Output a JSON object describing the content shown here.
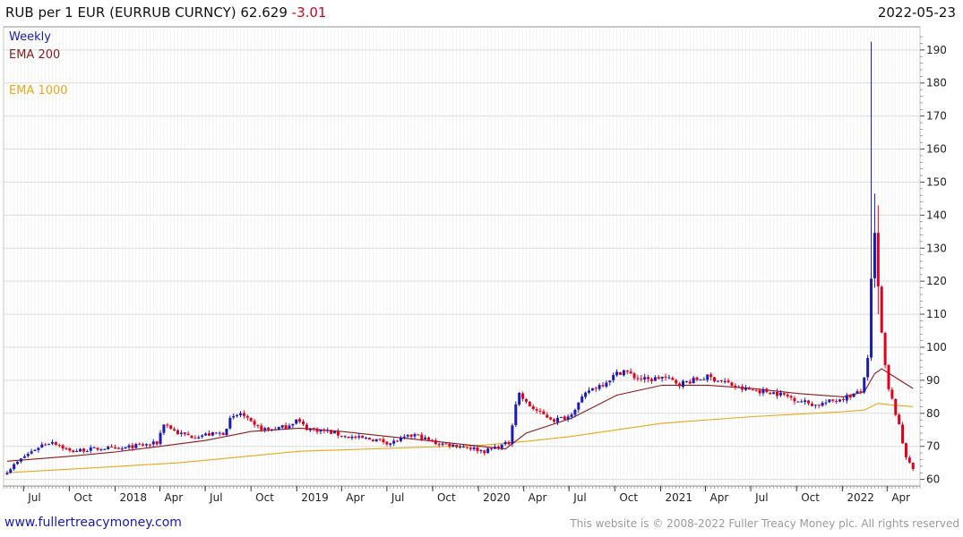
{
  "header": {
    "title": "RUB per 1 EUR (EURRUB CURNCY) 62.629",
    "change": "-3.01",
    "date": "2022-05-23"
  },
  "footer": {
    "left": "www.fullertreacymoney.com",
    "right": "This website is © 2008-2022 Fuller Treacy Money plc. All rights reserved"
  },
  "colors": {
    "up": "#1a1ab8",
    "down": "#e0001b",
    "ema200": "#8b1a1a",
    "ema1000": "#e6a817",
    "grid": "#d9d9d9"
  },
  "chart_data": {
    "type": "candlestick",
    "title": "RUB per 1 EUR (EURRUB CURNCY)",
    "frequency_label": "Weekly",
    "legend": [
      "Weekly",
      "EMA 200",
      "EMA 1000"
    ],
    "ylim": [
      58,
      197
    ],
    "yticks": [
      60,
      70,
      80,
      90,
      100,
      110,
      120,
      130,
      140,
      150,
      160,
      170,
      180,
      190
    ],
    "xlim": [
      "2017-05-22",
      "2022-06-06"
    ],
    "xticks": [
      {
        "label": "Jul",
        "date": "2017-07-01"
      },
      {
        "label": "Oct",
        "date": "2017-10-01"
      },
      {
        "label": "2018",
        "date": "2018-01-01"
      },
      {
        "label": "Apr",
        "date": "2018-04-01"
      },
      {
        "label": "Jul",
        "date": "2018-07-01"
      },
      {
        "label": "Oct",
        "date": "2018-10-01"
      },
      {
        "label": "2019",
        "date": "2019-01-01"
      },
      {
        "label": "Apr",
        "date": "2019-04-01"
      },
      {
        "label": "Jul",
        "date": "2019-07-01"
      },
      {
        "label": "Oct",
        "date": "2019-10-01"
      },
      {
        "label": "2020",
        "date": "2020-01-01"
      },
      {
        "label": "Apr",
        "date": "2020-04-01"
      },
      {
        "label": "Jul",
        "date": "2020-07-01"
      },
      {
        "label": "Oct",
        "date": "2020-10-01"
      },
      {
        "label": "2021",
        "date": "2021-01-01"
      },
      {
        "label": "Apr",
        "date": "2021-04-01"
      },
      {
        "label": "Jul",
        "date": "2021-07-01"
      },
      {
        "label": "Oct",
        "date": "2021-10-01"
      },
      {
        "label": "2022",
        "date": "2022-01-01"
      },
      {
        "label": "Apr",
        "date": "2022-04-01"
      }
    ],
    "close_path": [
      [
        "2017-05-29",
        62.5
      ],
      [
        "2017-07-03",
        67
      ],
      [
        "2017-08-07",
        70.5
      ],
      [
        "2017-08-28",
        71.5
      ],
      [
        "2017-10-02",
        68.5
      ],
      [
        "2017-11-06",
        69
      ],
      [
        "2017-12-11",
        69.5
      ],
      [
        "2018-01-08",
        69
      ],
      [
        "2018-02-05",
        70
      ],
      [
        "2018-03-05",
        70.5
      ],
      [
        "2018-03-26",
        71
      ],
      [
        "2018-04-09",
        77
      ],
      [
        "2018-05-07",
        74
      ],
      [
        "2018-06-04",
        73
      ],
      [
        "2018-07-02",
        73.5
      ],
      [
        "2018-08-06",
        74
      ],
      [
        "2018-08-20",
        78
      ],
      [
        "2018-09-10",
        80
      ],
      [
        "2018-10-08",
        76
      ],
      [
        "2018-11-05",
        75
      ],
      [
        "2018-12-10",
        76
      ],
      [
        "2018-12-31",
        78
      ],
      [
        "2019-01-21",
        75.5
      ],
      [
        "2019-03-04",
        74.5
      ],
      [
        "2019-04-08",
        73
      ],
      [
        "2019-05-06",
        72.5
      ],
      [
        "2019-06-10",
        72
      ],
      [
        "2019-07-08",
        71
      ],
      [
        "2019-08-05",
        72.5
      ],
      [
        "2019-08-26",
        73.5
      ],
      [
        "2019-10-07",
        71
      ],
      [
        "2019-11-04",
        70.5
      ],
      [
        "2019-12-09",
        69.8
      ],
      [
        "2020-01-13",
        68.5
      ],
      [
        "2020-02-10",
        70
      ],
      [
        "2020-03-02",
        71
      ],
      [
        "2020-03-09",
        77
      ],
      [
        "2020-03-16",
        83
      ],
      [
        "2020-03-23",
        86
      ],
      [
        "2020-04-06",
        83
      ],
      [
        "2020-05-04",
        80
      ],
      [
        "2020-06-01",
        78
      ],
      [
        "2020-06-29",
        79
      ],
      [
        "2020-07-20",
        83
      ],
      [
        "2020-08-10",
        87
      ],
      [
        "2020-09-07",
        89
      ],
      [
        "2020-10-05",
        92
      ],
      [
        "2020-10-19",
        93
      ],
      [
        "2020-11-09",
        91
      ],
      [
        "2020-12-07",
        90
      ],
      [
        "2021-01-04",
        91
      ],
      [
        "2021-02-08",
        89
      ],
      [
        "2021-03-08",
        90
      ],
      [
        "2021-04-05",
        91
      ],
      [
        "2021-05-10",
        89.5
      ],
      [
        "2021-06-07",
        87.5
      ],
      [
        "2021-07-05",
        87
      ],
      [
        "2021-08-09",
        86.5
      ],
      [
        "2021-09-06",
        85.5
      ],
      [
        "2021-10-04",
        84
      ],
      [
        "2021-11-08",
        82.5
      ],
      [
        "2021-12-06",
        83.5
      ],
      [
        "2022-01-10",
        85
      ],
      [
        "2022-02-07",
        86.5
      ],
      [
        "2022-02-21",
        96
      ],
      [
        "2022-02-28",
        120
      ],
      [
        "2022-03-07",
        134
      ],
      [
        "2022-03-14",
        118
      ],
      [
        "2022-03-21",
        104
      ],
      [
        "2022-03-28",
        94
      ],
      [
        "2022-04-04",
        87
      ],
      [
        "2022-04-11",
        84
      ],
      [
        "2022-04-18",
        80
      ],
      [
        "2022-04-25",
        76
      ],
      [
        "2022-05-02",
        71
      ],
      [
        "2022-05-09",
        67
      ],
      [
        "2022-05-16",
        65.5
      ],
      [
        "2022-05-23",
        62.6
      ]
    ],
    "spikes": [
      {
        "date": "2022-02-28",
        "high": 192.5,
        "low": 96
      },
      {
        "date": "2022-03-07",
        "high": 146.5,
        "low": 118
      },
      {
        "date": "2022-03-14",
        "high": 143,
        "low": 110
      }
    ],
    "ema200": [
      [
        "2017-05-29",
        65.5
      ],
      [
        "2017-10-02",
        67
      ],
      [
        "2018-01-01",
        68.3
      ],
      [
        "2018-04-02",
        70
      ],
      [
        "2018-07-02",
        71.8
      ],
      [
        "2018-10-01",
        74.5
      ],
      [
        "2019-01-07",
        75.5
      ],
      [
        "2019-04-01",
        74.5
      ],
      [
        "2019-07-01",
        73
      ],
      [
        "2019-10-07",
        71.5
      ],
      [
        "2020-01-06",
        70
      ],
      [
        "2020-02-24",
        69.2
      ],
      [
        "2020-04-06",
        74
      ],
      [
        "2020-07-06",
        78.5
      ],
      [
        "2020-10-05",
        85.5
      ],
      [
        "2021-01-04",
        88.5
      ],
      [
        "2021-04-05",
        88.5
      ],
      [
        "2021-07-05",
        87.5
      ],
      [
        "2021-10-04",
        86
      ],
      [
        "2022-01-03",
        85
      ],
      [
        "2022-02-14",
        86.5
      ],
      [
        "2022-03-07",
        92
      ],
      [
        "2022-03-21",
        93.5
      ],
      [
        "2022-04-11",
        91.5
      ],
      [
        "2022-05-23",
        87.5
      ]
    ],
    "ema1000": [
      [
        "2017-05-29",
        62
      ],
      [
        "2018-05-07",
        65
      ],
      [
        "2019-01-07",
        68.5
      ],
      [
        "2020-01-06",
        70.3
      ],
      [
        "2020-04-06",
        71.5
      ],
      [
        "2020-07-06",
        73
      ],
      [
        "2021-01-04",
        77
      ],
      [
        "2021-07-05",
        79
      ],
      [
        "2022-01-03",
        80.5
      ],
      [
        "2022-02-14",
        81
      ],
      [
        "2022-03-14",
        83
      ],
      [
        "2022-04-11",
        82.5
      ],
      [
        "2022-05-23",
        82
      ]
    ]
  }
}
